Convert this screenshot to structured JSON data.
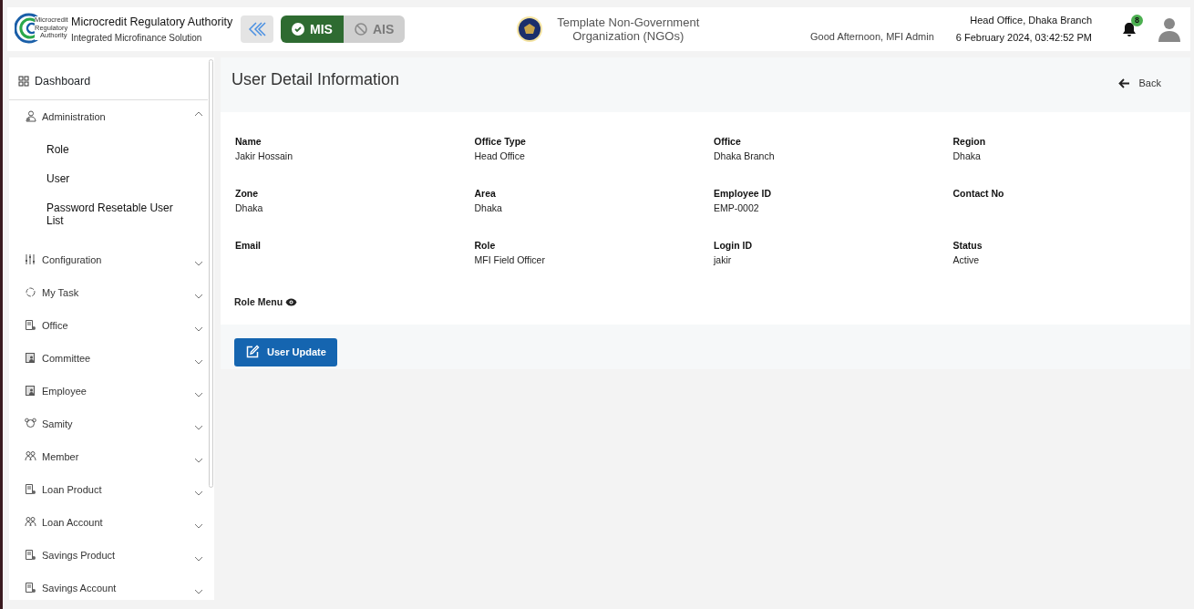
{
  "header": {
    "logo_text": [
      "Microcredit",
      "Regulatory",
      "Authority"
    ],
    "org_name": "Microcredit Regulatory Authority",
    "org_subtitle": "Integrated Microfinance Solution",
    "modules": [
      {
        "label": "MIS",
        "selected": true
      },
      {
        "label": "AIS",
        "selected": false
      }
    ],
    "ngo_name": "Template Non-Government Organization (NGOs)",
    "greeting": "Good Afternoon, MFI Admin",
    "branch": "Head Office, Dhaka Branch",
    "datetime": "6 February 2024, 03:42:52 PM",
    "notification_count": "8"
  },
  "sidebar": {
    "items": [
      {
        "label": "Dashboard",
        "kind": "link"
      },
      {
        "label": "Administration",
        "kind": "group",
        "expanded": true,
        "children": [
          {
            "label": "Role"
          },
          {
            "label": "User"
          },
          {
            "label": "Password Resetable User List"
          }
        ]
      },
      {
        "label": "Configuration",
        "kind": "group",
        "expanded": false
      },
      {
        "label": "My Task",
        "kind": "group",
        "expanded": false
      },
      {
        "label": "Office",
        "kind": "group",
        "expanded": false
      },
      {
        "label": "Committee",
        "kind": "group",
        "expanded": false
      },
      {
        "label": "Employee",
        "kind": "group",
        "expanded": false
      },
      {
        "label": "Samity",
        "kind": "group",
        "expanded": false
      },
      {
        "label": "Member",
        "kind": "group",
        "expanded": false
      },
      {
        "label": "Loan Product",
        "kind": "group",
        "expanded": false
      },
      {
        "label": "Loan Account",
        "kind": "group",
        "expanded": false
      },
      {
        "label": "Savings Product",
        "kind": "group",
        "expanded": false
      },
      {
        "label": "Savings Account",
        "kind": "group",
        "expanded": false
      }
    ]
  },
  "page": {
    "title": "User Detail Information",
    "back_label": "Back",
    "fields": [
      {
        "label": "Name",
        "value": "Jakir Hossain"
      },
      {
        "label": "Office Type",
        "value": "Head Office"
      },
      {
        "label": "Office",
        "value": "Dhaka Branch"
      },
      {
        "label": "Region",
        "value": "Dhaka"
      },
      {
        "label": "Zone",
        "value": "Dhaka"
      },
      {
        "label": "Area",
        "value": "Dhaka"
      },
      {
        "label": "Employee ID",
        "value": "EMP-0002"
      },
      {
        "label": "Contact No"
      },
      {
        "label": "Email"
      },
      {
        "label": "Role",
        "value": "MFI Field Officer"
      },
      {
        "label": "Login ID",
        "value": "jakir"
      },
      {
        "label": "Status",
        "value": "Active"
      }
    ],
    "role_menu_label": "Role Menu",
    "update_button": "User Update"
  }
}
